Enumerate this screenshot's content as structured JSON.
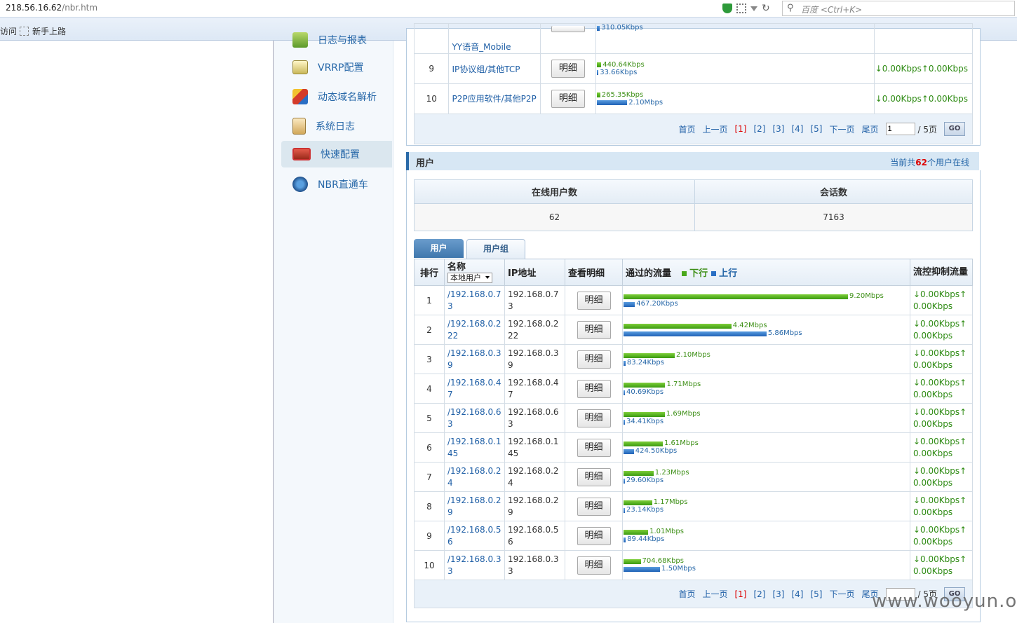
{
  "browser": {
    "url_host": "218.56.16.62",
    "url_path": "/nbr.htm",
    "search_placeholder": "百度 <Ctrl+K>",
    "bookmark_left": "访问",
    "bookmark_newbie": "新手上路"
  },
  "sidebar": {
    "items": [
      {
        "label": "日志与报表",
        "active": false
      },
      {
        "label": "VRRP配置",
        "active": false
      },
      {
        "label": "动态域名解析",
        "active": false
      },
      {
        "label": "系统日志",
        "active": false
      },
      {
        "label": "快速配置",
        "active": true
      },
      {
        "label": "NBR直通车",
        "active": false
      }
    ]
  },
  "app_table": {
    "partial_row": {
      "name": "YY语音_Mobile",
      "down_label": "310.05Kbps"
    },
    "rows": [
      {
        "rank": "9",
        "name": "IP协议组/其他TCP",
        "detail": "明细",
        "down": "440.64Kbps",
        "down_frac": 0.004,
        "up": "33.66Kbps",
        "up_frac": 0.0003,
        "ctrl": "↓0.00Kbps↑0.00Kbps"
      },
      {
        "rank": "10",
        "name": "P2P应用软件/其他P2P",
        "detail": "明细",
        "down": "265.35Kbps",
        "down_frac": 0.003,
        "up": "2.10Mbps",
        "up_frac": 0.02,
        "ctrl": "↓0.00Kbps↑0.00Kbps"
      }
    ],
    "pager": {
      "first": "首页",
      "prev": "上一页",
      "pages": [
        "[1]",
        "[2]",
        "[3]",
        "[4]",
        "[5]"
      ],
      "next": "下一页",
      "last": "尾页",
      "input": "1",
      "total": "/ 5页",
      "go": "GO"
    }
  },
  "users_section": {
    "title": "用户",
    "status_prefix": "当前共",
    "status_count": "62",
    "status_suffix": "个用户在线",
    "summary_headers": [
      "在线用户数",
      "会话数"
    ],
    "summary_values": [
      "62",
      "7163"
    ],
    "tabs": [
      "用户",
      "用户组"
    ],
    "columns": {
      "rank": "排行",
      "name": "名称",
      "name_filter": "本地用户",
      "ip": "IP地址",
      "detail": "查看明细",
      "traffic": "通过的流量",
      "legend_down": "下行",
      "legend_up": "上行",
      "ctrl": "流控抑制流量"
    },
    "rows": [
      {
        "rank": "1",
        "name": "/192.168.0.73",
        "ip": "192.168.0.73",
        "detail": "明细",
        "down": "9.20Mbps",
        "down_mbps": 9.2,
        "up": "467.20Kbps",
        "up_mbps": 0.467,
        "ctrl": "↓0.00Kbps↑0.00Kbps"
      },
      {
        "rank": "2",
        "name": "/192.168.0.222",
        "ip": "192.168.0.222",
        "detail": "明细",
        "down": "4.42Mbps",
        "down_mbps": 4.42,
        "up": "5.86Mbps",
        "up_mbps": 5.86,
        "ctrl": "↓0.00Kbps↑0.00Kbps"
      },
      {
        "rank": "3",
        "name": "/192.168.0.39",
        "ip": "192.168.0.39",
        "detail": "明细",
        "down": "2.10Mbps",
        "down_mbps": 2.1,
        "up": "83.24Kbps",
        "up_mbps": 0.083,
        "ctrl": "↓0.00Kbps↑0.00Kbps"
      },
      {
        "rank": "4",
        "name": "/192.168.0.47",
        "ip": "192.168.0.47",
        "detail": "明细",
        "down": "1.71Mbps",
        "down_mbps": 1.71,
        "up": "40.69Kbps",
        "up_mbps": 0.041,
        "ctrl": "↓0.00Kbps↑0.00Kbps"
      },
      {
        "rank": "5",
        "name": "/192.168.0.63",
        "ip": "192.168.0.63",
        "detail": "明细",
        "down": "1.69Mbps",
        "down_mbps": 1.69,
        "up": "34.41Kbps",
        "up_mbps": 0.034,
        "ctrl": "↓0.00Kbps↑0.00Kbps"
      },
      {
        "rank": "6",
        "name": "/192.168.0.145",
        "ip": "192.168.0.145",
        "detail": "明细",
        "down": "1.61Mbps",
        "down_mbps": 1.61,
        "up": "424.50Kbps",
        "up_mbps": 0.425,
        "ctrl": "↓0.00Kbps↑0.00Kbps"
      },
      {
        "rank": "7",
        "name": "/192.168.0.24",
        "ip": "192.168.0.24",
        "detail": "明细",
        "down": "1.23Mbps",
        "down_mbps": 1.23,
        "up": "29.60Kbps",
        "up_mbps": 0.03,
        "ctrl": "↓0.00Kbps↑0.00Kbps"
      },
      {
        "rank": "8",
        "name": "/192.168.0.29",
        "ip": "192.168.0.29",
        "detail": "明细",
        "down": "1.17Mbps",
        "down_mbps": 1.17,
        "up": "23.14Kbps",
        "up_mbps": 0.023,
        "ctrl": "↓0.00Kbps↑0.00Kbps"
      },
      {
        "rank": "9",
        "name": "/192.168.0.56",
        "ip": "192.168.0.56",
        "detail": "明细",
        "down": "1.01Mbps",
        "down_mbps": 1.01,
        "up": "89.44Kbps",
        "up_mbps": 0.089,
        "ctrl": "↓0.00Kbps↑0.00Kbps"
      },
      {
        "rank": "10",
        "name": "/192.168.0.33",
        "ip": "192.168.0.33",
        "detail": "明细",
        "down": "704.68Kbps",
        "down_mbps": 0.705,
        "up": "1.50Mbps",
        "up_mbps": 1.5,
        "ctrl": "↓0.00Kbps↑0.00Kbps"
      }
    ],
    "pager": {
      "first": "首页",
      "prev": "上一页",
      "pages": [
        "[1]",
        "[2]",
        "[3]",
        "[4]",
        "[5]"
      ],
      "next": "下一页",
      "last": "尾页",
      "total": "/ 5页"
    }
  },
  "watermark": "www.wooyun.org",
  "colors": {
    "down": "#4aa81c",
    "up": "#2a6fc4",
    "accent": "#2a6aa8",
    "highlight": "#dd0000"
  }
}
